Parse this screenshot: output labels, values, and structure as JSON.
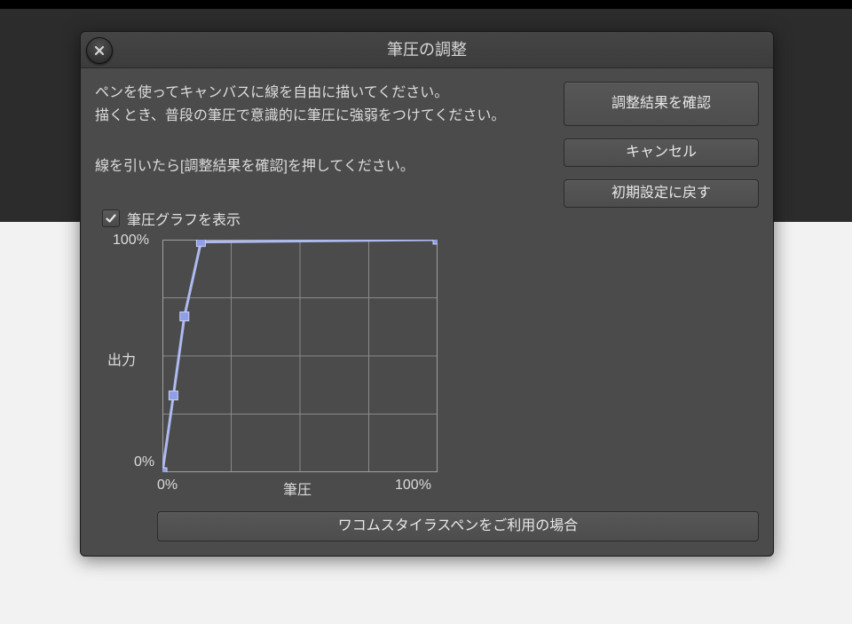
{
  "dialog": {
    "title": "筆圧の調整",
    "instructions": {
      "line1a": "ペンを使ってキャンバスに線を自由に描いてください。",
      "line1b": "描くとき、普段の筆圧で意識的に筆圧に強弱をつけてください。",
      "line2": "線を引いたら[調整結果を確認]を押してください。"
    },
    "buttons": {
      "confirm": "調整結果を確認",
      "cancel": "キャンセル",
      "reset": "初期設定に戻す",
      "wacom": "ワコムスタイラスペンをご利用の場合"
    },
    "checkbox": {
      "show_graph": "筆圧グラフを表示",
      "checked": true
    },
    "graph": {
      "y_max": "100%",
      "y_min": "0%",
      "y_label": "出力",
      "x_min": "0%",
      "x_max": "100%",
      "x_label": "筆圧"
    }
  },
  "chart_data": {
    "type": "line",
    "title": "筆圧の調整",
    "xlabel": "筆圧",
    "ylabel": "出力",
    "xlim": [
      0,
      100
    ],
    "ylim": [
      0,
      100
    ],
    "points": [
      {
        "x": 0,
        "y": 0
      },
      {
        "x": 4,
        "y": 33
      },
      {
        "x": 8,
        "y": 67
      },
      {
        "x": 14,
        "y": 99
      },
      {
        "x": 100,
        "y": 100
      }
    ]
  }
}
